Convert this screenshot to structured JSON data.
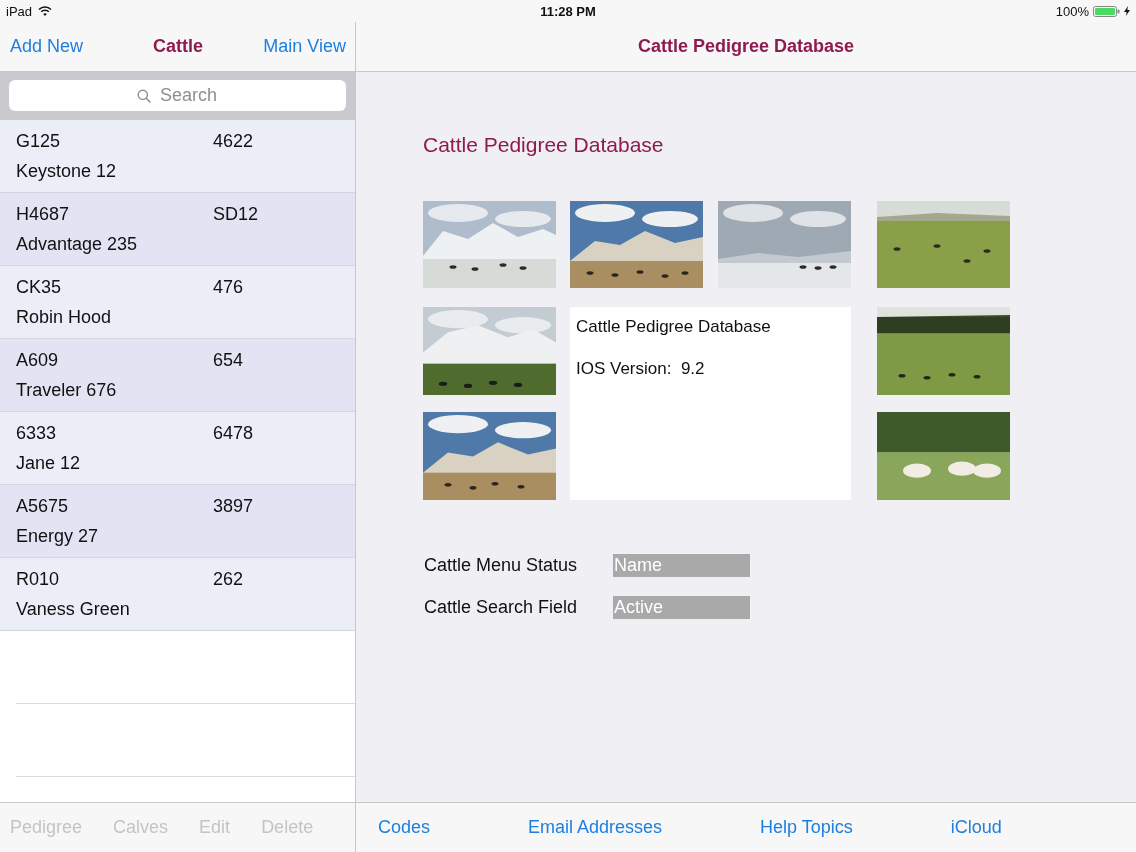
{
  "status_bar": {
    "carrier": "iPad",
    "time": "11:28 PM",
    "battery": "100%"
  },
  "master": {
    "nav_bar": {
      "left_button": "Add New",
      "title": "Cattle",
      "right_button": "Main View"
    },
    "search": {
      "placeholder": "Search"
    },
    "rows": [
      {
        "code": "G125",
        "number": "4622",
        "name": "Keystone 12"
      },
      {
        "code": "H4687",
        "number": "SD12",
        "name": "Advantage 235"
      },
      {
        "code": "CK35",
        "number": "476",
        "name": "Robin Hood"
      },
      {
        "code": "A609",
        "number": "654",
        "name": "Traveler 676"
      },
      {
        "code": "6333",
        "number": "6478",
        "name": "Jane 12"
      },
      {
        "code": "A5675",
        "number": "3897",
        "name": "Energy 27"
      },
      {
        "code": "R010",
        "number": "262",
        "name": "Vaness Green"
      }
    ],
    "toolbar": [
      {
        "label": "Pedigree",
        "disabled": true
      },
      {
        "label": "Calves",
        "disabled": true
      },
      {
        "label": "Edit",
        "disabled": true
      },
      {
        "label": "Delete",
        "disabled": true
      }
    ]
  },
  "detail": {
    "nav_bar": {
      "title": "Cattle Pedigree Database"
    },
    "heading": "Cattle Pedigree Database",
    "info_card": {
      "title": "Cattle Pedigree Database",
      "version": "IOS Version:  9.2"
    },
    "fields": [
      {
        "label": "Cattle Menu Status",
        "value": "Name"
      },
      {
        "label": "Cattle Search Field",
        "value": "Active"
      }
    ],
    "toolbar": [
      {
        "label": "Codes",
        "disabled": false
      },
      {
        "label": "Email Addresses",
        "disabled": false
      },
      {
        "label": "Help Topics",
        "disabled": false
      },
      {
        "label": "iCloud",
        "disabled": false
      }
    ]
  }
}
